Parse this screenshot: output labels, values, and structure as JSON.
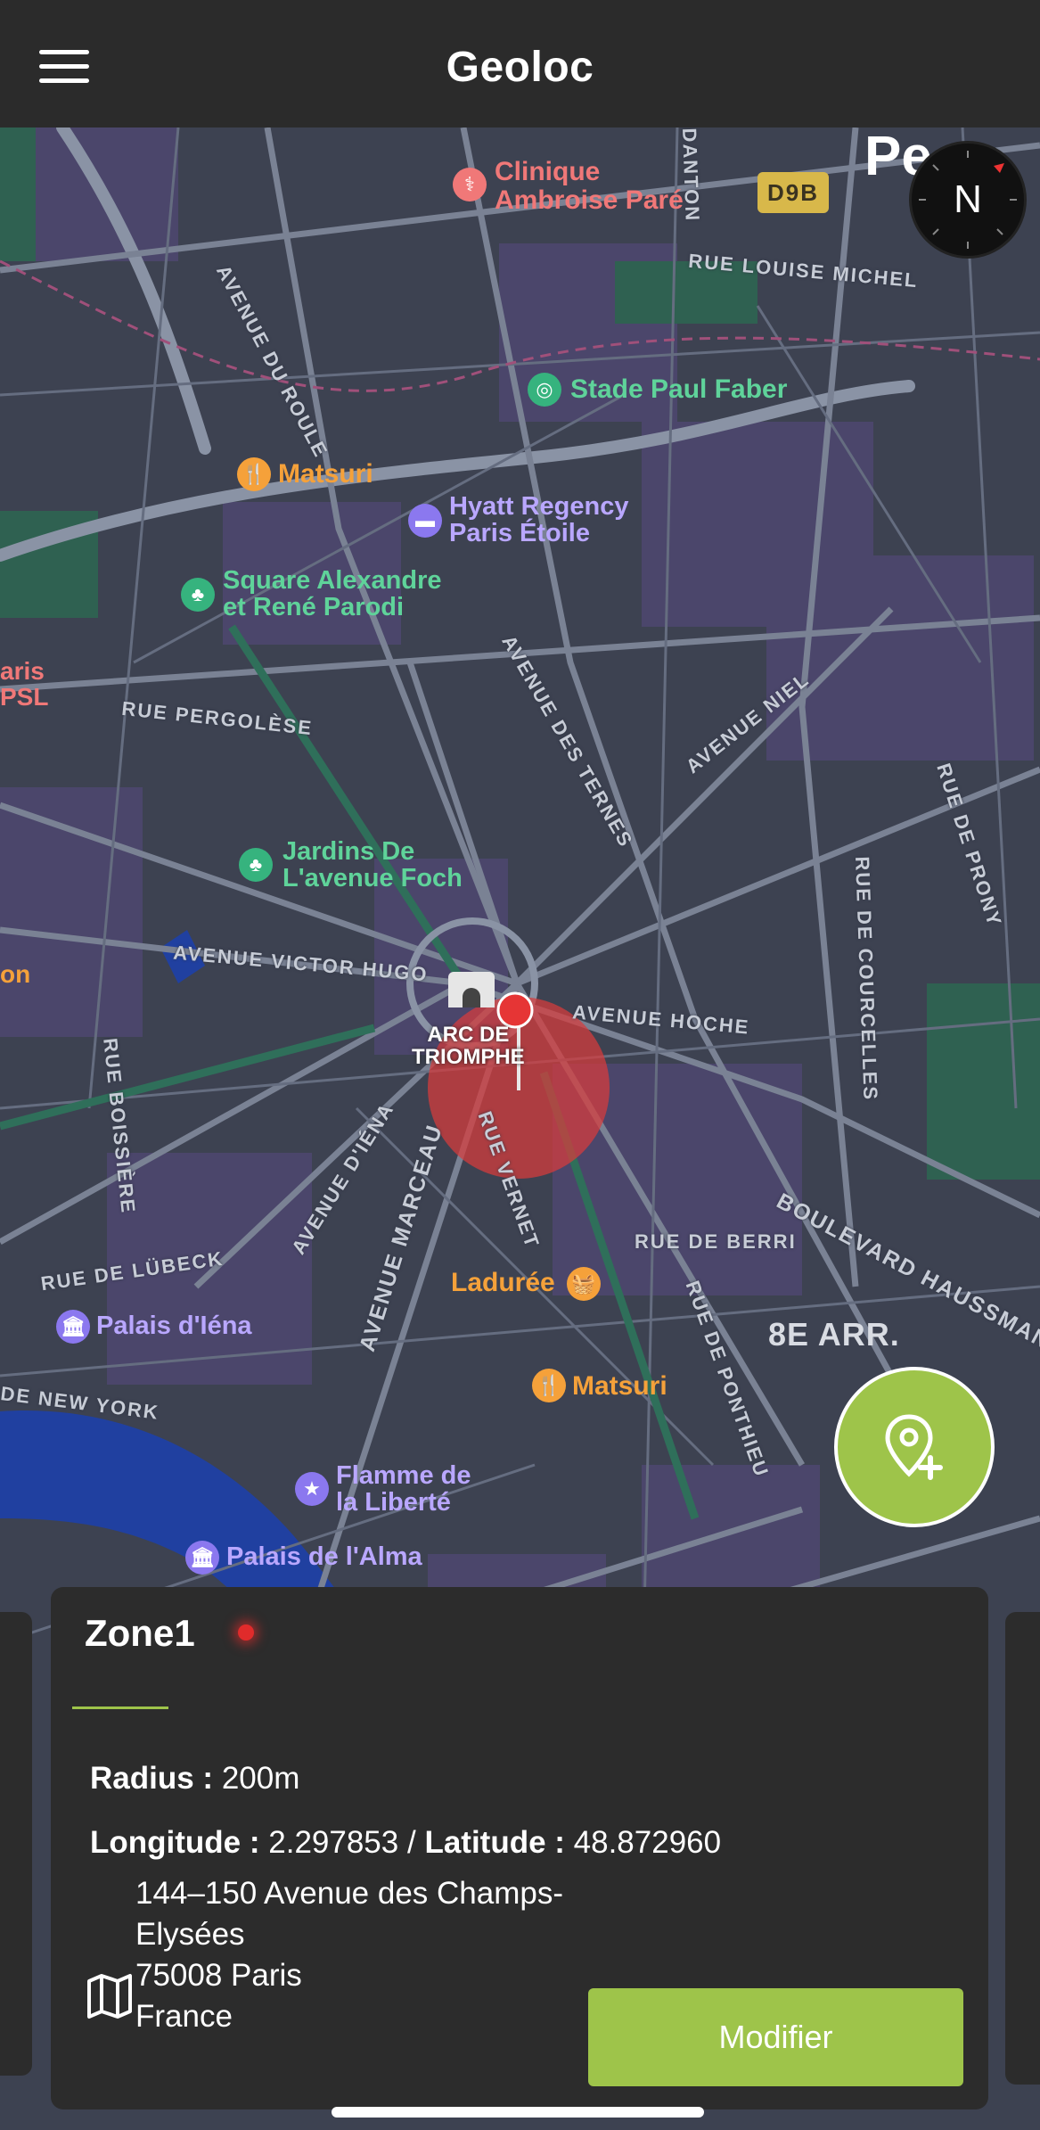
{
  "app": {
    "title": "Geoloc"
  },
  "map": {
    "places": [
      {
        "name": "Clinique\nAmbroise Paré",
        "color": "#f07878"
      },
      {
        "name": "Stade Paul Faber",
        "color": "#5fd39a"
      },
      {
        "name": "Matsuri",
        "color": "#f5a13a"
      },
      {
        "name": "Hyatt Regency\nParis Étoile",
        "color": "#b9a7ff"
      },
      {
        "name": "Square Alexandre\net René Parodi",
        "color": "#5fd39a"
      },
      {
        "name": "Jardins De\nL'avenue Foch",
        "color": "#5fd39a"
      },
      {
        "name": "ARC DE\nTRIOMPHE",
        "color": "#ffffff"
      },
      {
        "name": "Ladurée",
        "color": "#f5a13a"
      },
      {
        "name": "Palais d'Iéna",
        "color": "#b9a7ff"
      },
      {
        "name": "Matsuri",
        "color": "#f5a13a"
      },
      {
        "name": "Flamme de\nla Liberté",
        "color": "#b9a7ff"
      },
      {
        "name": "Palais de l'Alma",
        "color": "#b9a7ff"
      },
      {
        "name": "8E ARR.",
        "color": "#d9dce3"
      },
      {
        "name": "D9B",
        "color": "#3a3320"
      },
      {
        "name": "Pe",
        "color": "#ffffff"
      },
      {
        "name": "aris\nPSL",
        "color": "#f07878"
      },
      {
        "name": "on",
        "color": "#f5a13a"
      }
    ],
    "streets": [
      "AVENUE DU ROULE",
      "RUE LOUISE MICHEL",
      "RUE PERGOLÈSE",
      "AVENUE DES TERNES",
      "AVENUE NIEL",
      "RUE DE PRONY",
      "RUE DE COURCELLES",
      "AVENUE VICTOR HUGO",
      "AVENUE HOCHE",
      "RUE BOISSIÈRE",
      "RUE VERNET",
      "AVENUE D'IÉNA",
      "AVENUE MARCEAU",
      "RUE DE BERRI",
      "BOULEVARD HAUSSMANN",
      "RUE DE LÜBECK",
      "RUE DE PONTHIEU",
      "DE NEW YORK",
      "DANTON"
    ],
    "compass_label": "N"
  },
  "zone_card": {
    "name": "Zone1",
    "radius_label": "Radius :",
    "radius_value": "200m",
    "longitude_label": "Longitude :",
    "longitude_value": "2.297853",
    "separator": "/",
    "latitude_label": "Latitude :",
    "latitude_value": "48.872960",
    "address_line1": "144–150 Avenue des Champs-",
    "address_line2": "Elysées",
    "address_line3": "75008 Paris",
    "address_line4": "France",
    "modify_label": "Modifier",
    "status_color": "#e02b2b"
  },
  "colors": {
    "accent": "#9ec44a",
    "header_bg": "#2b2b2b",
    "card_bg": "#2c2c2c",
    "zone_circle": "#d83b3b"
  }
}
